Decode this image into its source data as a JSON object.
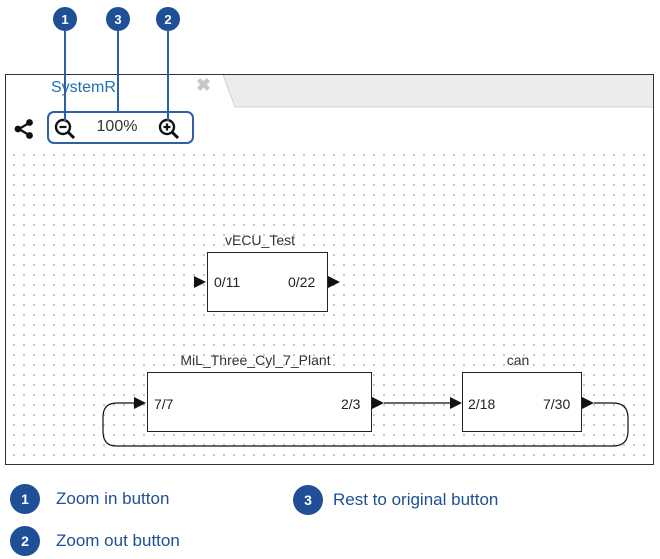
{
  "tab": {
    "title": "SystemR",
    "close_glyph": "✖"
  },
  "toolbar": {
    "zoom_level": "100%",
    "icons": [
      "share-icon",
      "zoom-out-icon",
      "zoom-in-icon"
    ]
  },
  "callouts": {
    "c1": "1",
    "c3": "3",
    "c2": "2"
  },
  "blocks": {
    "vecu": {
      "name": "vECU_Test",
      "in_port": "0/11",
      "out_port": "0/22"
    },
    "mil": {
      "name": "MiL_Three_Cyl_7_Plant",
      "in_port": "7/7",
      "out_port": "2/3"
    },
    "can": {
      "name": "can",
      "in_port": "2/18",
      "out_port": "7/30"
    }
  },
  "legend": [
    {
      "number": "1",
      "text": "Zoom  in button"
    },
    {
      "number": "3",
      "text": "Rest to original button"
    },
    {
      "number": "2",
      "text": "Zoom out button"
    }
  ],
  "colors": {
    "accent": "#1f4f96",
    "tab_title": "#1f6fb2"
  }
}
